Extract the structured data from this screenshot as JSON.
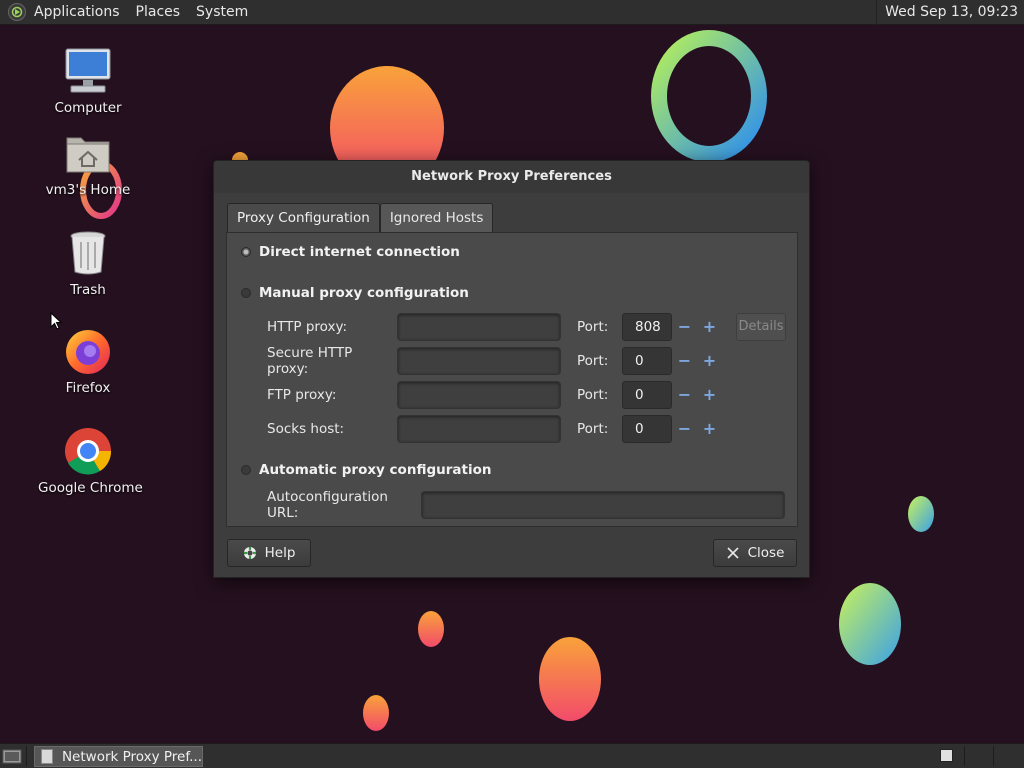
{
  "top_panel": {
    "menus": [
      "Applications",
      "Places",
      "System"
    ],
    "clock": "Wed Sep 13, 09:23"
  },
  "desktop": {
    "icons": [
      {
        "label": "Computer",
        "icon": "computer-icon"
      },
      {
        "label": "vm3's Home",
        "icon": "home-folder-icon"
      },
      {
        "label": "Trash",
        "icon": "trash-icon"
      },
      {
        "label": "Firefox",
        "icon": "firefox-icon"
      },
      {
        "label": "Google Chrome",
        "icon": "chrome-icon"
      }
    ]
  },
  "dialog": {
    "title": "Network Proxy Preferences",
    "tabs": [
      {
        "label": "Proxy Configuration",
        "active": true
      },
      {
        "label": "Ignored Hosts",
        "active": false
      }
    ],
    "direct": {
      "label": "Direct internet connection",
      "selected": true
    },
    "manual": {
      "label": "Manual proxy configuration",
      "selected": false,
      "rows": [
        {
          "label": "HTTP proxy:",
          "host": "",
          "port_label": "Port:",
          "port": "808"
        },
        {
          "label": "Secure HTTP proxy:",
          "host": "",
          "port_label": "Port:",
          "port": "0"
        },
        {
          "label": "FTP proxy:",
          "host": "",
          "port_label": "Port:",
          "port": "0"
        },
        {
          "label": "Socks host:",
          "host": "",
          "port_label": "Port:",
          "port": "0"
        }
      ],
      "details_label": "Details",
      "minus": "−",
      "plus": "+"
    },
    "automatic": {
      "label": "Automatic proxy configuration",
      "selected": false,
      "url_label": "Autoconfiguration URL:",
      "url": ""
    },
    "help_label": "Help",
    "close_label": "Close"
  },
  "bottom_panel": {
    "taskbar_item": "Network Proxy Pref..."
  },
  "colors": {
    "panel_bg": "#2f2f2f",
    "dialog_bg": "#3d3d3d",
    "spin_accent": "#7ea8e0",
    "wallpaper": "#25101f"
  }
}
